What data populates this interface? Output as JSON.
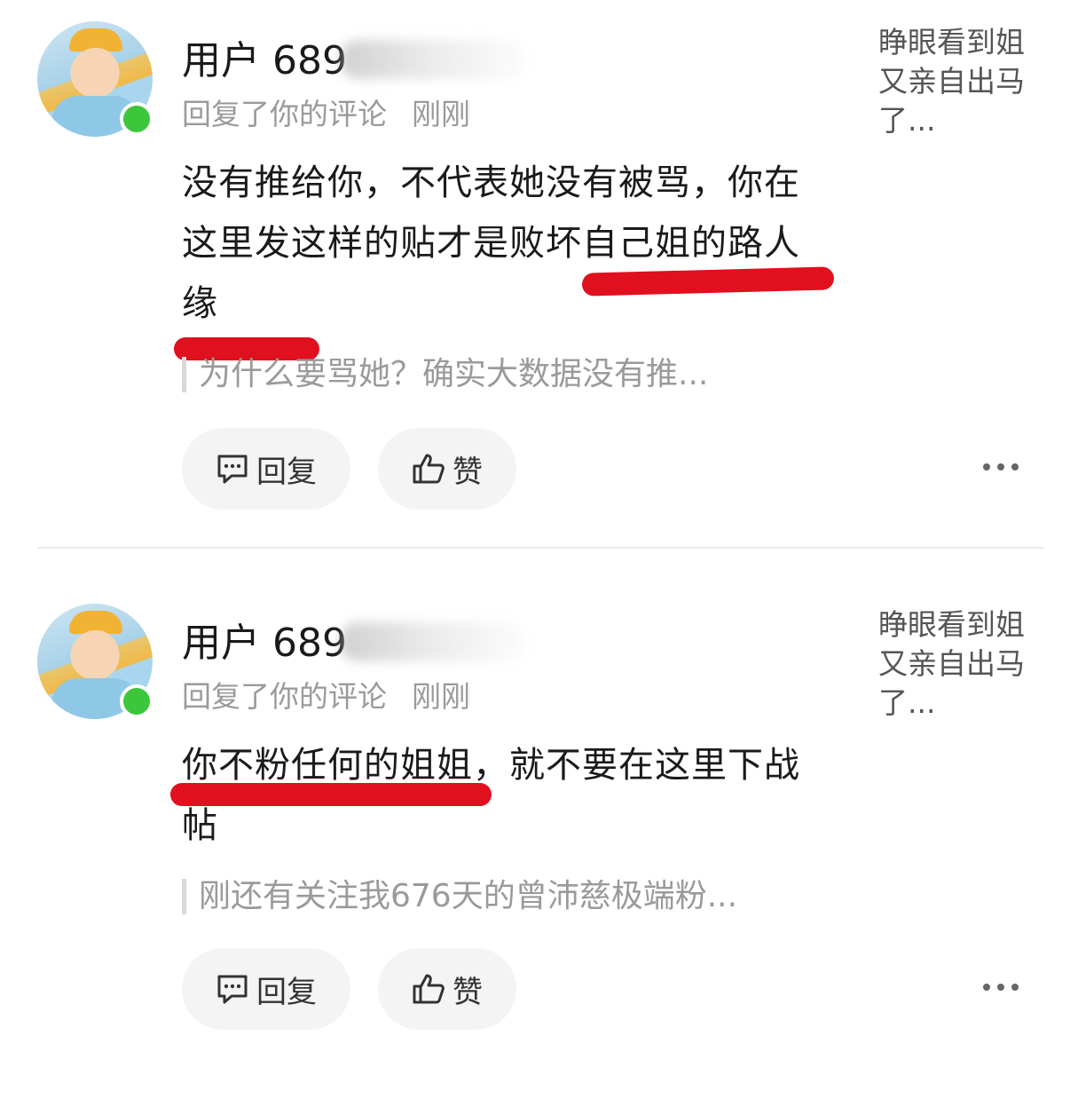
{
  "notifications": [
    {
      "username_visible": "用户 689",
      "action": "回复了你的评论",
      "time": "刚刚",
      "preview": "睁眼看到姐又亲自出马了...",
      "comment": "没有推给你，不代表她没有被骂，你在这里发这样的贴才是败坏自己姐的路人缘",
      "quote": "为什么要骂她？确实大数据没有推...",
      "reply_label": "回复",
      "like_label": "赞"
    },
    {
      "username_visible": "用户 689",
      "action": "回复了你的评论",
      "time": "刚刚",
      "preview": "睁眼看到姐又亲自出马了...",
      "comment": "你不粉任何的姐姐，就不要在这里下战帖",
      "quote": "刚还有关注我676天的曾沛慈极端粉...",
      "reply_label": "回复",
      "like_label": "赞"
    }
  ],
  "colors": {
    "underline": "#e0101e",
    "online": "#3cc63c",
    "muted_text": "#9a9a9a",
    "button_bg": "#f4f4f4"
  }
}
